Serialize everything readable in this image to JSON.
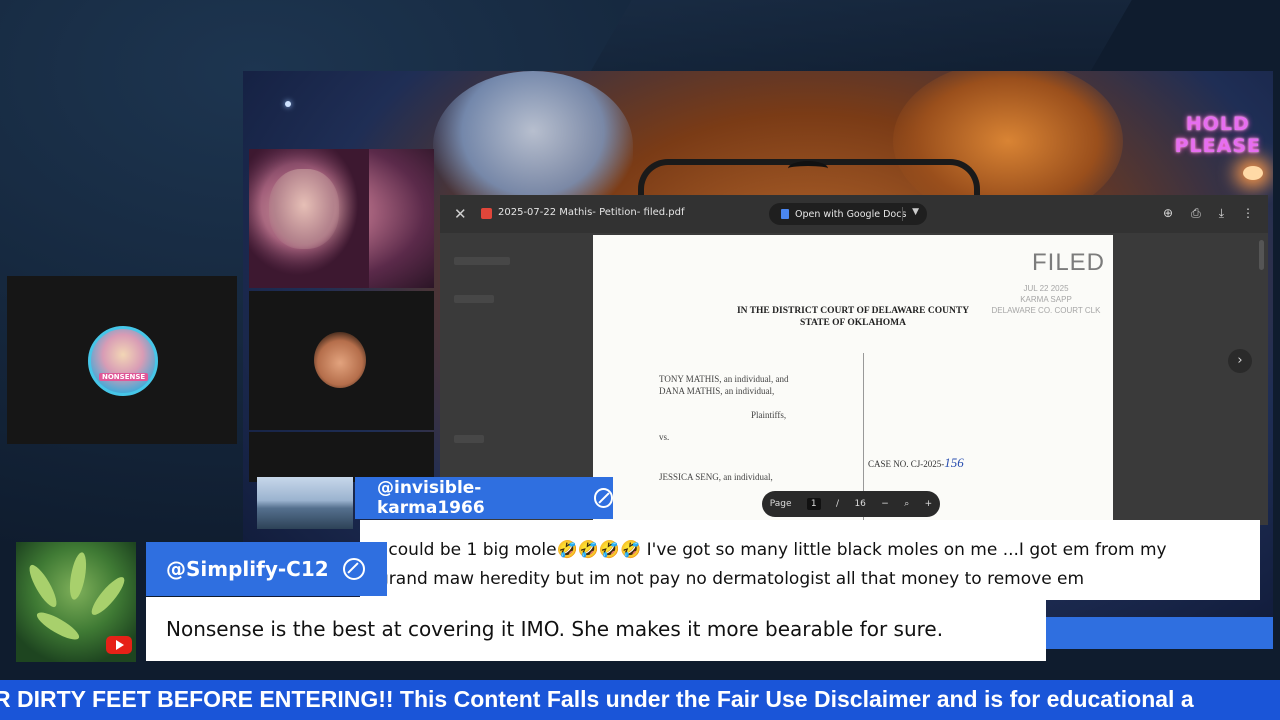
{
  "stream": {
    "overlay_text_line1": "HOLD",
    "overlay_text_line2": "PLEASE"
  },
  "pdf_viewer": {
    "file_name": "2025-07-22 Mathis- Petition- filed.pdf",
    "open_with_label": "Open with Google Docs",
    "page_label": "Page",
    "current_page": "1",
    "page_separator": "/",
    "total_pages": "16",
    "document": {
      "filed_label": "FILED",
      "stamp_date": "JUL 22 2025",
      "stamp_clerk": "KARMA SAPP",
      "stamp_office": "DELAWARE CO. COURT CLK",
      "court_line1": "IN THE DISTRICT COURT OF DELAWARE COUNTY",
      "court_line2": "STATE OF OKLAHOMA",
      "plaintiff1": "TONY MATHIS, an individual, and",
      "plaintiff2": "DANA MATHIS, an individual,",
      "plaintiffs_label": "Plaintiffs,",
      "vs_label": "vs.",
      "defendant1": "JESSICA SENG, an individual,",
      "case_no_label": "CASE NO. CJ-2025-",
      "case_no_value": "156"
    }
  },
  "participants": {
    "avatar_label": "NONSENSE"
  },
  "chat_message_1": {
    "username": "@invisible-karma1966",
    "text_line1": "I could be 1 big mole🤣🤣🤣🤣 I've got so many little black moles on me ...I got em from my",
    "text_line2": "grand maw heredity but im not pay no dermatologist all that money to remove em"
  },
  "chat_message_2": {
    "username": "@Simplify-C12",
    "text": "Nonsense is the best at covering it IMO. She makes it more bearable for sure."
  },
  "ticker": {
    "text": "R DIRTY FEET BEFORE ENTERING!! This Content Falls under the Fair Use Disclaimer and is for educational a"
  },
  "colors": {
    "accent_blue": "#2f6fe0",
    "ticker_blue": "#1a55d8",
    "hold_pink": "#e66ef0"
  }
}
